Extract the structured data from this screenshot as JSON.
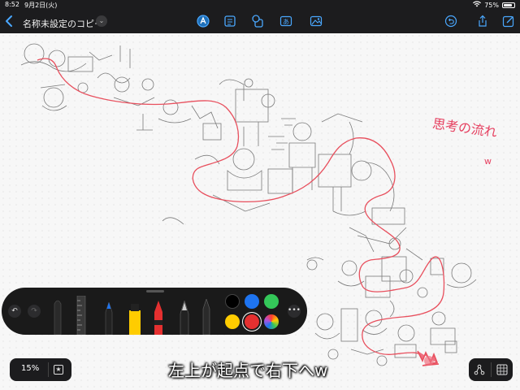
{
  "statusbar": {
    "time": "8:52",
    "date": "9月2日(火)",
    "battery": "75%",
    "battery_level": 0.75
  },
  "toolbar": {
    "title": "名称未設定のコピー",
    "icons": [
      "back-icon",
      "pen-tool-icon",
      "note-icon",
      "shapes-icon",
      "text-icon",
      "image-icon",
      "undo-icon",
      "share-icon",
      "new-board-icon"
    ]
  },
  "canvas": {
    "handwritten_note": "思考の流れ",
    "handwritten_suffix": "w",
    "caption": "左上が起点で右下へw",
    "stroke_color": "#e64060"
  },
  "palette": {
    "tools": [
      "pen-eraser",
      "ruler",
      "pencil-blue",
      "marker-yellow",
      "crayon-red",
      "fountain-pen",
      "pen-black"
    ],
    "colors": [
      "#000000",
      "#1e74f0",
      "#34c759",
      "#ffcc00",
      "#e53030",
      "rainbow"
    ],
    "selected_color": "#e53030"
  },
  "bottom": {
    "zoom": "15%"
  }
}
